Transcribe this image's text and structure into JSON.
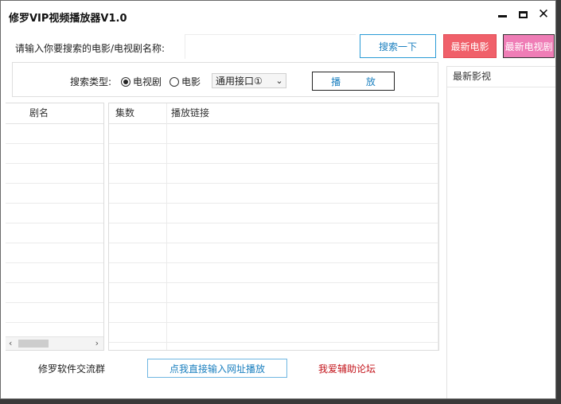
{
  "window": {
    "title": "修罗VIP视频播放器V1.0"
  },
  "search": {
    "label": "请输入你要搜索的电影/电视剧名称:",
    "value": "",
    "button": "搜索一下"
  },
  "buttons": {
    "latest_movies": "最新电影",
    "latest_tv": "最新电视剧",
    "play": "播 放",
    "direct_url": "点我直接输入网址播放"
  },
  "search_type": {
    "label": "搜索类型:",
    "options": [
      "电视剧",
      "电影"
    ],
    "selected": "电视剧",
    "api_select": "通用接口①"
  },
  "drama_list": {
    "column": "剧名"
  },
  "episodes": {
    "columns": [
      "集数",
      "播放链接"
    ]
  },
  "latest": {
    "header": "最新影视"
  },
  "footer": {
    "group_label": "修罗软件交流群",
    "forum_link": "我爱辅助论坛"
  },
  "colors": {
    "accent_blue": "#1a7fbf",
    "movies_btn": "#f0606a",
    "tv_btn": "#ef7db6",
    "forum_red": "#c3141b"
  }
}
